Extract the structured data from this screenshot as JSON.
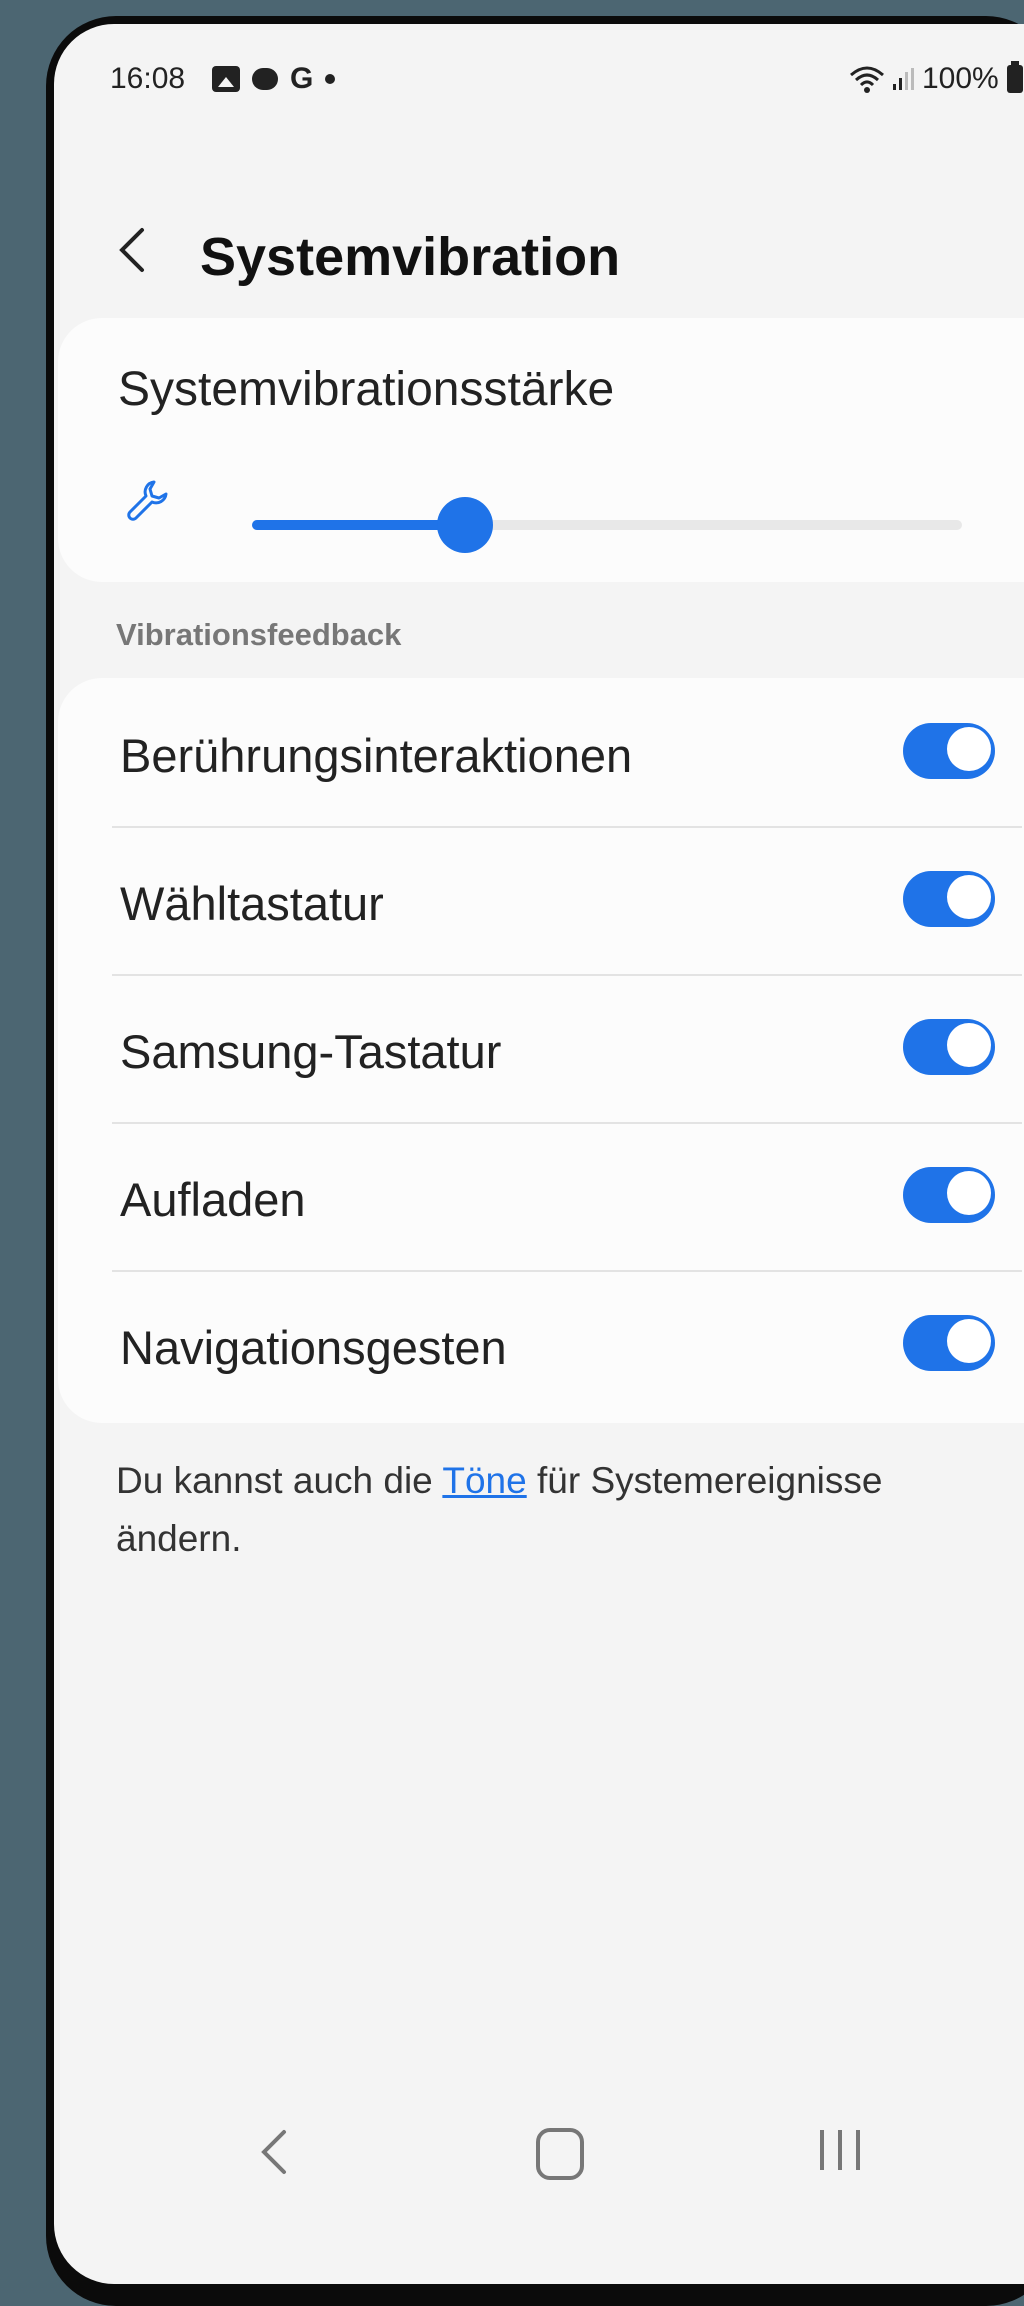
{
  "status_bar": {
    "time": "16:08",
    "left_icons": [
      "gallery-icon",
      "chat-icon",
      "google-icon",
      "dot-icon"
    ],
    "right_icons": [
      "wifi-icon",
      "signal-icon",
      "battery-icon"
    ],
    "battery": "100%"
  },
  "header": {
    "title": "Systemvibration",
    "back_icon": "chevron-left-icon"
  },
  "slider_card": {
    "label": "Systemvibrationsstärke",
    "icon": "wrench-icon",
    "level_fraction": 0.3
  },
  "section": {
    "label": "Vibrationsfeedback"
  },
  "toggles": [
    {
      "label": "Berührungsinteraktionen",
      "on": true
    },
    {
      "label": "Wähltastatur",
      "on": true
    },
    {
      "label": "Samsung-Tastatur",
      "on": true
    },
    {
      "label": "Aufladen",
      "on": true
    },
    {
      "label": "Navigationsgesten",
      "on": true
    }
  ],
  "footer": {
    "text_before": "Du kannst auch die ",
    "link": "Töne",
    "text_after": " für Systemereignisse ändern."
  },
  "navbar": {
    "icons": [
      "back-icon",
      "home-icon",
      "recents-icon"
    ]
  },
  "colors": {
    "accent": "#1f73e8",
    "background": "#f4f4f4",
    "card": "#fcfcfc"
  }
}
